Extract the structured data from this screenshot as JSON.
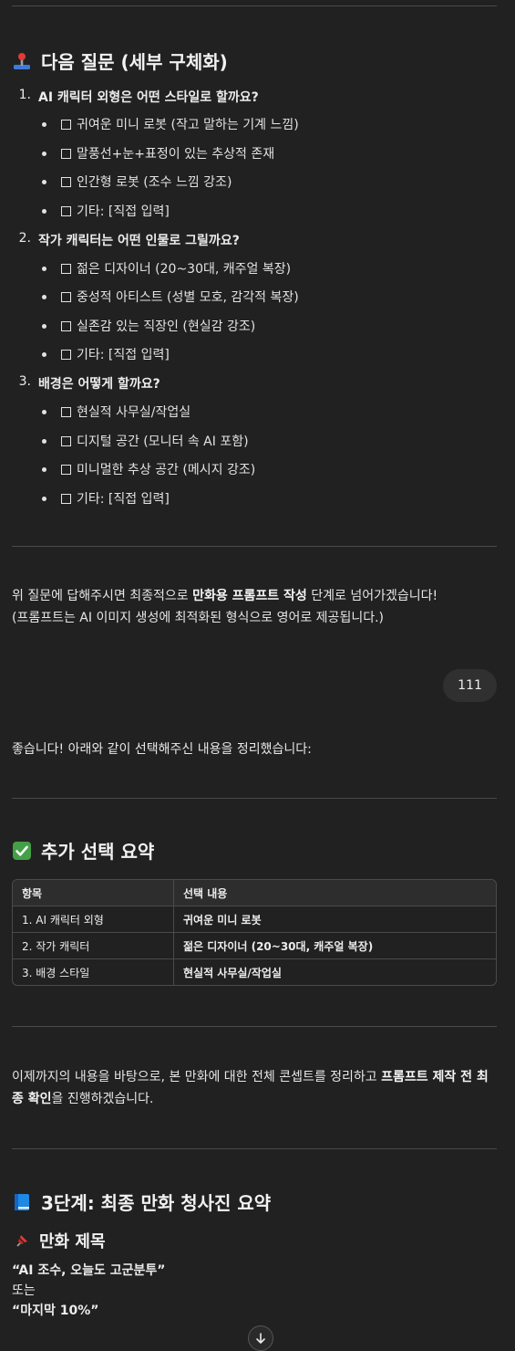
{
  "next_questions": {
    "heading": "다음 질문 (세부 구체화)",
    "heading_icon": "joystick-icon",
    "questions": [
      {
        "num": "1.",
        "text": "AI 캐릭터 외형은 어떤 스타일로 할까요?",
        "options": [
          "귀여운 미니 로봇 (작고 말하는 기계 느낌)",
          "말풍선+눈+표정이 있는 추상적 존재",
          "인간형 로봇 (조수 느낌 강조)",
          "기타: [직접 입력]"
        ]
      },
      {
        "num": "2.",
        "text": "작가 캐릭터는 어떤 인물로 그릴까요?",
        "options": [
          "젊은 디자이너 (20~30대, 캐주얼 복장)",
          "중성적 아티스트 (성별 모호, 감각적 복장)",
          "실존감 있는 직장인 (현실감 강조)",
          "기타: [직접 입력]"
        ]
      },
      {
        "num": "3.",
        "text": "배경은 어떻게 할까요?",
        "options": [
          "현실적 사무실/작업실",
          "디지털 공간 (모니터 속 AI 포함)",
          "미니멀한 추상 공간 (메시지 강조)",
          "기타: [직접 입력]"
        ]
      }
    ]
  },
  "closing_para": {
    "pre": "위 질문에 답해주시면 최종적으로 ",
    "bold": "만화용 프롬프트 작성",
    "post": " 단계로 넘어가겠습니다!",
    "line2": "(프롬프트는 AI 이미지 생성에 최적화된 형식으로 영어로 제공됩니다.)"
  },
  "user_message": "111",
  "reply_intro": "좋습니다! 아래와 같이 선택해주신 내용을 정리했습니다:",
  "summary": {
    "heading": "추가 선택 요약",
    "heading_icon": "check-mark-icon",
    "col_item": "항목",
    "col_value": "선택 내용",
    "rows": [
      {
        "item": "1. AI 캐릭터 외형",
        "value": "귀여운 미니 로봇"
      },
      {
        "item": "2. 작가 캐릭터",
        "value": "젊은 디자이너 (20~30대, 캐주얼 복장)"
      },
      {
        "item": "3. 배경 스타일",
        "value": "현실적 사무실/작업실"
      }
    ]
  },
  "concept_para": {
    "pre": "이제까지의 내용을 바탕으로, 본 만화에 대한 전체 콘셉트를 정리하고 ",
    "bold": "프롬프트 제작 전 최종 확인",
    "post": "을 진행하겠습니다."
  },
  "stage3": {
    "heading": "3단계: 최종 만화 청사진 요약",
    "heading_icon": "blue-book-icon",
    "sub_heading": "만화 제목",
    "sub_icon": "pushpin-icon",
    "title1": "“AI 조수, 오늘도 고군분투”",
    "or": "또는",
    "title2": "“마지막 10%”"
  },
  "colors": {
    "background": "#212121",
    "bubble": "#303030",
    "divider": "#4a4a4a"
  }
}
